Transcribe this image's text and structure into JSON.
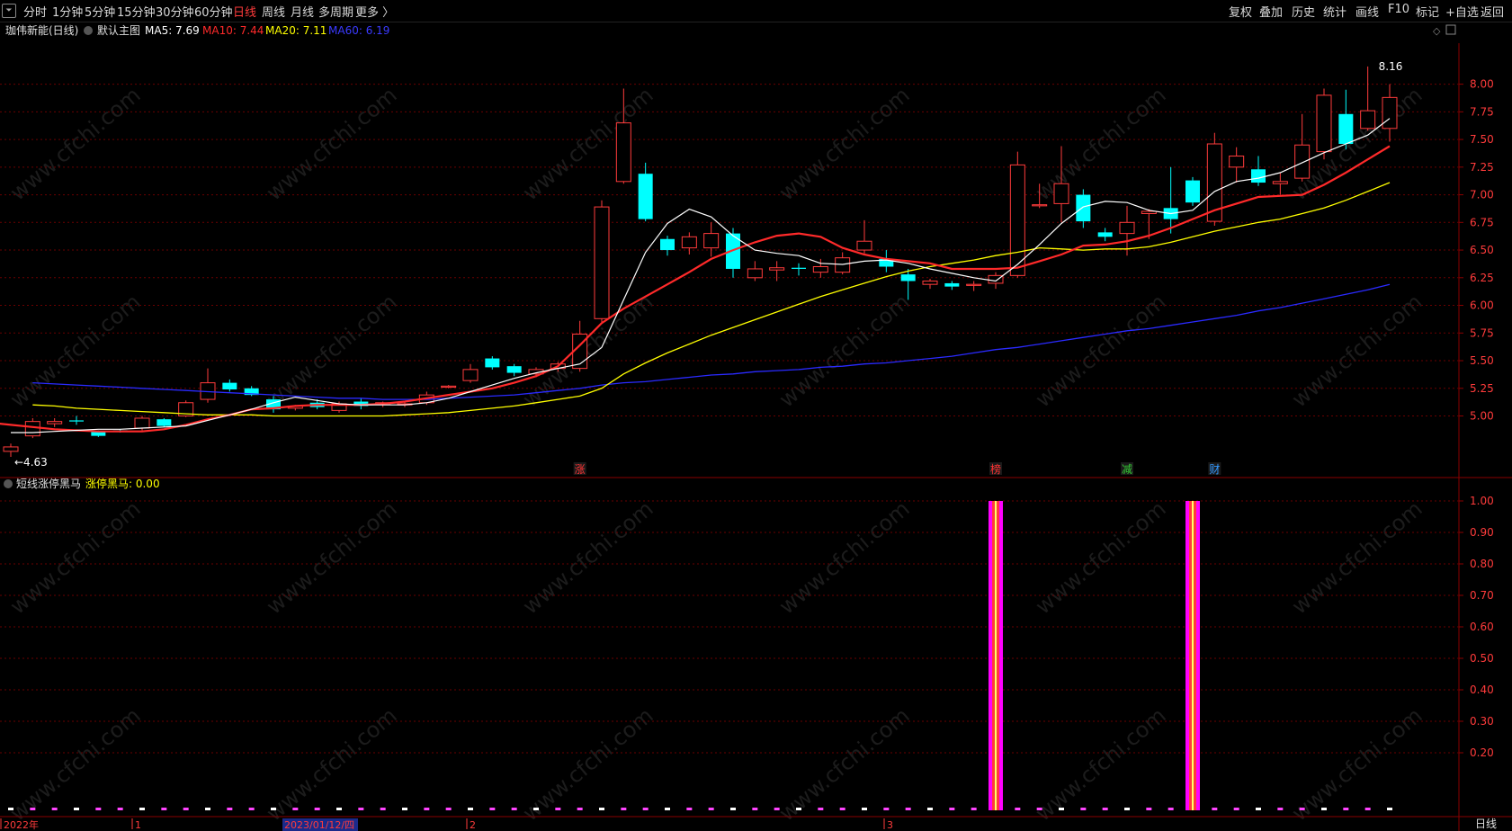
{
  "toolbar": {
    "system_icon": "⏷",
    "left_items": [
      "分时",
      "1分钟",
      "5分钟",
      "15分钟",
      "30分钟",
      "60分钟",
      "日线",
      "周线",
      "月线",
      "多周期",
      "更多 〉"
    ],
    "active_index": 6,
    "right_items": [
      "复权",
      "叠加",
      "历史",
      "统计",
      "画线",
      "F10",
      "标记",
      "+自选",
      "返回"
    ]
  },
  "main_panel": {
    "stock_name": "珈伟新能(日线)",
    "template": "默认主图",
    "indicators": [
      {
        "label": "MA5: 7.69",
        "color": "#ffffff"
      },
      {
        "label": "MA10: 7.44",
        "color": "#ff2a2a"
      },
      {
        "label": "MA20: 7.11",
        "color": "#ffff00"
      },
      {
        "label": "MA60: 6.19",
        "color": "#3a3aff"
      }
    ],
    "high_label": "8.16",
    "low_label": "4.63",
    "event_markers": [
      {
        "text": "涨",
        "index": 26,
        "color": "#ff3333"
      },
      {
        "text": "榜",
        "index": 45,
        "color": "#ff3333"
      },
      {
        "text": "减",
        "index": 51,
        "color": "#33cc33"
      },
      {
        "text": "财",
        "index": 55,
        "color": "#3399ff"
      }
    ]
  },
  "sub_panel": {
    "title": "短线涨停黑马",
    "indicator_label": "涨停黑马: 0.00",
    "spike_indices": [
      45,
      54
    ],
    "y_ticks": [
      "1.00",
      "0.90",
      "0.80",
      "0.70",
      "0.60",
      "0.50",
      "0.40",
      "0.30",
      "0.20"
    ]
  },
  "x_axis": {
    "labels": [
      "2022年",
      "1",
      "2023/01/12/四",
      "2",
      "3"
    ],
    "period": "日线"
  },
  "watermark": "www.cfchi.com",
  "colors": {
    "up": "#ff3b3b",
    "down": "#00ffff",
    "ma5": "#ffffff",
    "ma10": "#ff2a2a",
    "ma20": "#ffff00",
    "ma60": "#2a2aff",
    "grid": "#6a0000"
  },
  "chart_data": {
    "type": "candlestick",
    "ylim": [
      4.5,
      8.2
    ],
    "y_ticks": [
      "8.00",
      "7.75",
      "7.50",
      "7.25",
      "7.00",
      "6.75",
      "6.50",
      "6.25",
      "6.00",
      "5.75",
      "5.50",
      "5.25",
      "5.00"
    ],
    "candles": [
      [
        4.68,
        4.72,
        4.75,
        4.63
      ],
      [
        4.82,
        4.95,
        4.98,
        4.8
      ],
      [
        4.93,
        4.95,
        4.98,
        4.9
      ],
      [
        4.96,
        4.95,
        5.0,
        4.92
      ],
      [
        4.86,
        4.82,
        4.87,
        4.81
      ],
      [
        4.87,
        4.86,
        4.88,
        4.85
      ],
      [
        4.89,
        4.98,
        5.0,
        4.87
      ],
      [
        4.97,
        4.91,
        4.98,
        4.9
      ],
      [
        5.0,
        5.12,
        5.14,
        4.99
      ],
      [
        5.15,
        5.3,
        5.43,
        5.12
      ],
      [
        5.3,
        5.24,
        5.33,
        5.22
      ],
      [
        5.25,
        5.19,
        5.27,
        5.18
      ],
      [
        5.15,
        5.06,
        5.18,
        5.03
      ],
      [
        5.07,
        5.09,
        5.1,
        5.05
      ],
      [
        5.12,
        5.08,
        5.15,
        5.06
      ],
      [
        5.05,
        5.11,
        5.13,
        5.03
      ],
      [
        5.13,
        5.09,
        5.16,
        5.06
      ],
      [
        5.11,
        5.12,
        5.13,
        5.08
      ],
      [
        5.1,
        5.11,
        5.13,
        5.08
      ],
      [
        5.12,
        5.19,
        5.22,
        5.1
      ],
      [
        5.26,
        5.27,
        5.28,
        5.25
      ],
      [
        5.32,
        5.42,
        5.47,
        5.3
      ],
      [
        5.52,
        5.44,
        5.54,
        5.42
      ],
      [
        5.45,
        5.39,
        5.47,
        5.36
      ],
      [
        5.38,
        5.42,
        5.44,
        5.35
      ],
      [
        5.43,
        5.47,
        5.49,
        5.4
      ],
      [
        5.43,
        5.74,
        5.86,
        5.4
      ],
      [
        5.88,
        6.89,
        6.95,
        5.85
      ],
      [
        7.12,
        7.65,
        7.96,
        7.1
      ],
      [
        7.19,
        6.78,
        7.29,
        6.76
      ],
      [
        6.6,
        6.5,
        6.63,
        6.45
      ],
      [
        6.52,
        6.62,
        6.66,
        6.46
      ],
      [
        6.52,
        6.65,
        6.75,
        6.44
      ],
      [
        6.65,
        6.33,
        6.7,
        6.25
      ],
      [
        6.25,
        6.33,
        6.4,
        6.22
      ],
      [
        6.32,
        6.34,
        6.4,
        6.22
      ],
      [
        6.34,
        6.33,
        6.38,
        6.27
      ],
      [
        6.3,
        6.35,
        6.42,
        6.25
      ],
      [
        6.3,
        6.43,
        6.48,
        6.28
      ],
      [
        6.5,
        6.58,
        6.77,
        6.47
      ],
      [
        6.42,
        6.35,
        6.5,
        6.3
      ],
      [
        6.28,
        6.22,
        6.33,
        6.05
      ],
      [
        6.19,
        6.22,
        6.24,
        6.15
      ],
      [
        6.2,
        6.17,
        6.22,
        6.14
      ],
      [
        6.18,
        6.19,
        6.22,
        6.13
      ],
      [
        6.2,
        6.27,
        6.3,
        6.15
      ],
      [
        6.27,
        7.27,
        7.39,
        6.25
      ],
      [
        6.9,
        6.91,
        7.1,
        6.88
      ],
      [
        6.92,
        7.1,
        7.44,
        6.75
      ],
      [
        7.0,
        6.76,
        7.05,
        6.7
      ],
      [
        6.66,
        6.62,
        6.7,
        6.58
      ],
      [
        6.65,
        6.75,
        6.9,
        6.45
      ],
      [
        6.83,
        6.85,
        6.87,
        6.6
      ],
      [
        6.88,
        6.78,
        7.25,
        6.65
      ],
      [
        7.13,
        6.93,
        7.16,
        6.9
      ],
      [
        6.76,
        7.46,
        7.56,
        6.72
      ],
      [
        7.25,
        7.35,
        7.43,
        7.11
      ],
      [
        7.23,
        7.11,
        7.35,
        7.08
      ],
      [
        7.1,
        7.12,
        7.2,
        7.0
      ],
      [
        7.15,
        7.45,
        7.73,
        7.12
      ],
      [
        7.39,
        7.9,
        7.96,
        7.32
      ],
      [
        7.73,
        7.46,
        7.95,
        7.41
      ],
      [
        7.6,
        7.76,
        8.16,
        7.58
      ],
      [
        7.6,
        7.88,
        8.0,
        7.48
      ]
    ],
    "ma5": [
      4.85,
      4.85,
      4.86,
      4.87,
      4.88,
      4.88,
      4.89,
      4.9,
      4.91,
      4.96,
      5.01,
      5.06,
      5.12,
      5.17,
      5.14,
      5.11,
      5.1,
      5.1,
      5.1,
      5.12,
      5.16,
      5.22,
      5.28,
      5.34,
      5.39,
      5.43,
      5.47,
      5.62,
      6.05,
      6.48,
      6.74,
      6.87,
      6.8,
      6.63,
      6.5,
      6.47,
      6.45,
      6.38,
      6.37,
      6.4,
      6.41,
      6.38,
      6.33,
      6.29,
      6.25,
      6.22,
      6.37,
      6.55,
      6.74,
      6.89,
      6.94,
      6.93,
      6.86,
      6.83,
      6.86,
      7.03,
      7.12,
      7.15,
      7.2,
      7.29,
      7.38,
      7.46,
      7.54,
      7.69
    ],
    "ma10": [
      4.96,
      4.94,
      4.92,
      4.9,
      4.88,
      4.87,
      4.86,
      4.86,
      4.86,
      4.88,
      4.92,
      4.97,
      5.01,
      5.06,
      5.07,
      5.09,
      5.1,
      5.1,
      5.1,
      5.11,
      5.13,
      5.16,
      5.19,
      5.22,
      5.25,
      5.3,
      5.36,
      5.45,
      5.64,
      5.84,
      5.97,
      6.08,
      6.19,
      6.3,
      6.42,
      6.5,
      6.57,
      6.63,
      6.65,
      6.62,
      6.52,
      6.46,
      6.42,
      6.4,
      6.38,
      6.33,
      6.33,
      6.33,
      6.34,
      6.4,
      6.46,
      6.54,
      6.55,
      6.58,
      6.63,
      6.7,
      6.78,
      6.86,
      6.92,
      6.98,
      6.99,
      7.0,
      7.09,
      7.2,
      7.32,
      7.44
    ],
    "ma20": [
      5.1,
      5.09,
      5.07,
      5.06,
      5.05,
      5.04,
      5.03,
      5.02,
      5.01,
      5.01,
      5.01,
      5.0,
      5.0,
      5.0,
      5.0,
      5.0,
      5.0,
      5.01,
      5.02,
      5.03,
      5.05,
      5.07,
      5.09,
      5.12,
      5.15,
      5.18,
      5.25,
      5.38,
      5.48,
      5.57,
      5.65,
      5.73,
      5.8,
      5.87,
      5.94,
      6.01,
      6.08,
      6.14,
      6.2,
      6.26,
      6.31,
      6.35,
      6.38,
      6.41,
      6.45,
      6.48,
      6.52,
      6.51,
      6.5,
      6.51,
      6.51,
      6.53,
      6.57,
      6.62,
      6.67,
      6.71,
      6.75,
      6.78,
      6.83,
      6.88,
      6.95,
      7.03,
      7.11
    ],
    "ma60": [
      5.3,
      5.29,
      5.28,
      5.27,
      5.26,
      5.25,
      5.24,
      5.23,
      5.22,
      5.21,
      5.2,
      5.19,
      5.18,
      5.17,
      5.16,
      5.16,
      5.15,
      5.15,
      5.15,
      5.16,
      5.17,
      5.18,
      5.19,
      5.21,
      5.23,
      5.25,
      5.28,
      5.3,
      5.31,
      5.33,
      5.35,
      5.37,
      5.38,
      5.4,
      5.41,
      5.42,
      5.44,
      5.45,
      5.47,
      5.48,
      5.5,
      5.52,
      5.54,
      5.57,
      5.6,
      5.62,
      5.65,
      5.68,
      5.71,
      5.74,
      5.77,
      5.79,
      5.82,
      5.85,
      5.88,
      5.91,
      5.95,
      5.98,
      6.02,
      6.06,
      6.1,
      6.14,
      6.19
    ]
  }
}
